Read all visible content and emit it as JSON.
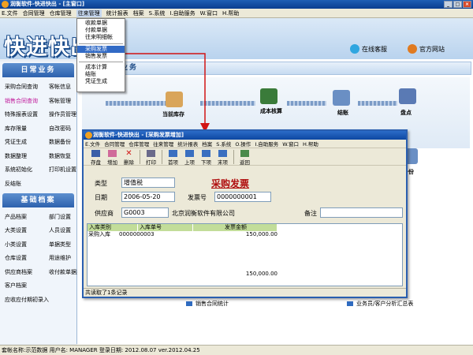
{
  "app": {
    "title": "润衡软件-快进快出 - [主窗口]",
    "logo": "快进快出"
  },
  "menu": [
    "E.文件",
    "合同管理",
    "仓库管理",
    "往来管理",
    "统计报表",
    "档案",
    "S.系统",
    "I.自助服务",
    "W.窗口",
    "H.帮助"
  ],
  "dropdown": {
    "group1": [
      "收款单据",
      "付款单据",
      "往来明细帐"
    ],
    "group2": [
      "采购发票",
      "销售发票"
    ],
    "group3": [
      "成本计算",
      "结账",
      "凭证生成"
    ],
    "selected": "采购发票"
  },
  "header_links": {
    "online": "在线客服",
    "site": "官方网站"
  },
  "sidebar": {
    "daily_title": "日常业务",
    "daily_items": [
      "采购合同查询",
      "客帐信息",
      "销售合同查询",
      "客帐管理",
      "特殊报表设置",
      "操作员管理",
      "库存限量",
      "自改密码",
      "凭证生成",
      "数据备份",
      "数据整理",
      "数据恢复",
      "系统初始化",
      "打印机设置",
      "反结账",
      ""
    ],
    "archive_title": "基础档案",
    "archive_items": [
      "产品档案",
      "部门设置",
      "大类设置",
      "人员设置",
      "小类设置",
      "单据类型",
      "仓库设置",
      "用途维护",
      "供应商档案",
      "收付款单据类",
      "客户档案",
      "",
      "应收应付期初录入",
      ""
    ]
  },
  "main": {
    "section_title": "常业务",
    "flow_labels": {
      "inventory": "当前库存",
      "cost": "成本核算",
      "settle": "结账",
      "stocktake": "盘点",
      "backup": "备份"
    },
    "bottom_links": [
      "销售合同统计",
      "业务员/客户分析汇总表"
    ]
  },
  "child": {
    "title": "润衡软件-快进快出 - [采购发票增加]",
    "menu": [
      "E.文件",
      "合同管理",
      "仓库管理",
      "往来管理",
      "统计报表",
      "档案",
      "S.系统",
      "O.操作",
      "I.自助服务",
      "W.窗口",
      "H.帮助"
    ],
    "toolbar": [
      "存盘",
      "增加",
      "删除",
      "打印",
      "首项",
      "上项",
      "下项",
      "末项",
      "返回"
    ],
    "heading": "采购发票",
    "fields": {
      "type_label": "类型",
      "type_value": "增值税",
      "date_label": "日期",
      "date_value": "2006-05-20",
      "invoice_label": "发票号",
      "invoice_value": "0000000001",
      "supplier_label": "供应商",
      "supplier_code": "G0003",
      "supplier_name": "北京润衡软件有限公司",
      "remark_label": "备注",
      "remark_value": ""
    },
    "grid": {
      "headers": [
        "入库类别",
        "入库单号",
        "发票金额"
      ],
      "rows": [
        [
          "采购入库",
          "0000000003",
          "150,000.00"
        ]
      ],
      "total": "150,000.00"
    },
    "status": "共读取了1条记录"
  },
  "status_bar": "套帐名称:示范数据   用户名: MANAGER   登录日期: 2012.08.07   ver.2012.04.25",
  "colors": {
    "title_blue": "#0d47a1",
    "accent_red": "#d11414",
    "pink": "#c0189a",
    "grid_head": "#c2dd99"
  }
}
